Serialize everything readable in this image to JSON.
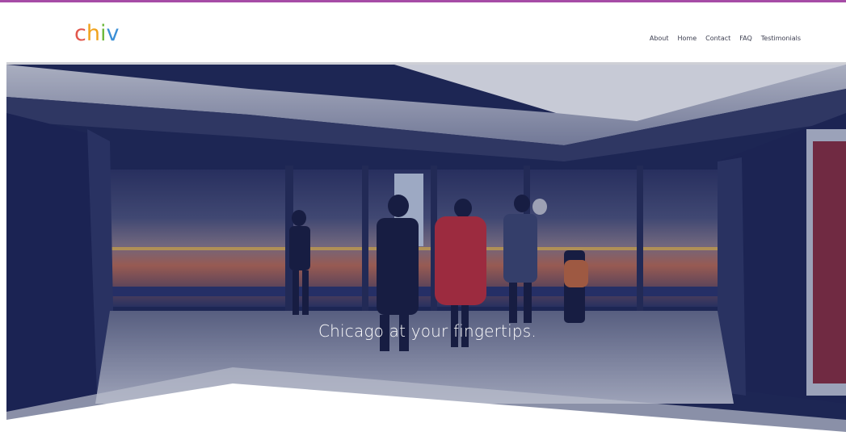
{
  "header": {
    "logo": {
      "letters": [
        {
          "char": "c",
          "color": "#e2574c"
        },
        {
          "char": "h",
          "color": "#f0a21b"
        },
        {
          "char": "i",
          "color": "#6db83a"
        },
        {
          "char": "v",
          "color": "#3a8fd6"
        },
        {
          "char": "",
          "color": "#b44fb4"
        }
      ]
    },
    "nav": [
      {
        "label": "About"
      },
      {
        "label": "Home"
      },
      {
        "label": "Contact"
      },
      {
        "label": "FAQ"
      },
      {
        "label": "Testimonials"
      }
    ]
  },
  "hero": {
    "tagline": "Chicago at your fingertips."
  },
  "colors": {
    "accent_bar": "#a64ca6",
    "overlay": "#1f2a5c"
  }
}
